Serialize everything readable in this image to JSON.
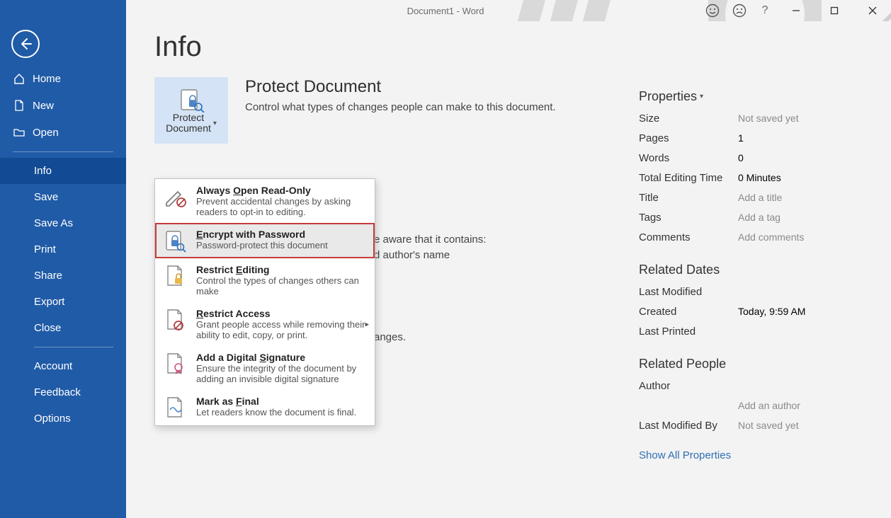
{
  "titlebar": {
    "doc_title": "Document1  -  Word",
    "help": "?"
  },
  "sidebar": {
    "items": [
      {
        "label": "Home"
      },
      {
        "label": "New"
      },
      {
        "label": "Open"
      },
      {
        "label": "Info"
      },
      {
        "label": "Save"
      },
      {
        "label": "Save As"
      },
      {
        "label": "Print"
      },
      {
        "label": "Share"
      },
      {
        "label": "Export"
      },
      {
        "label": "Close"
      },
      {
        "label": "Account"
      },
      {
        "label": "Feedback"
      },
      {
        "label": "Options"
      }
    ]
  },
  "page": {
    "title": "Info",
    "protect_button": "Protect\nDocument",
    "section_title": "Protect Document",
    "section_desc": "Control what types of changes people can make to this document.",
    "partial_lines": {
      "l1": "e aware that it contains:",
      "l2": "d author's name",
      "l3": "anges."
    }
  },
  "dropdown": {
    "items": [
      {
        "title_pre": "Always ",
        "title_ul": "O",
        "title_post": "pen Read-Only",
        "desc": "Prevent accidental changes by asking readers to opt-in to editing."
      },
      {
        "title_pre": "",
        "title_ul": "E",
        "title_post": "ncrypt with Password",
        "desc": "Password-protect this document"
      },
      {
        "title_pre": "Restrict ",
        "title_ul": "E",
        "title_post": "diting",
        "desc": "Control the types of changes others can make"
      },
      {
        "title_pre": "",
        "title_ul": "R",
        "title_post": "estrict Access",
        "desc": "Grant people access while removing their ability to edit, copy, or print.",
        "submenu": true
      },
      {
        "title_pre": "Add a Digital ",
        "title_ul": "S",
        "title_post": "ignature",
        "desc": "Ensure the integrity of the document by adding an invisible digital signature"
      },
      {
        "title_pre": "Mark as ",
        "title_ul": "F",
        "title_post": "inal",
        "desc": "Let readers know the document is final."
      }
    ]
  },
  "properties": {
    "heading": "Properties",
    "rows": [
      {
        "k": "Size",
        "v": "Not saved yet",
        "ph": true
      },
      {
        "k": "Pages",
        "v": "1"
      },
      {
        "k": "Words",
        "v": "0"
      },
      {
        "k": "Total Editing Time",
        "v": "0 Minutes"
      },
      {
        "k": "Title",
        "v": "Add a title",
        "ph": true
      },
      {
        "k": "Tags",
        "v": "Add a tag",
        "ph": true
      },
      {
        "k": "Comments",
        "v": "Add comments",
        "ph": true
      }
    ],
    "dates_heading": "Related Dates",
    "dates": [
      {
        "k": "Last Modified",
        "v": ""
      },
      {
        "k": "Created",
        "v": "Today, 9:59 AM"
      },
      {
        "k": "Last Printed",
        "v": ""
      }
    ],
    "people_heading": "Related People",
    "author_k": "Author",
    "add_author": "Add an author",
    "last_mod_by_k": "Last Modified By",
    "last_mod_by_v": "Not saved yet",
    "show_all": "Show All Properties"
  }
}
